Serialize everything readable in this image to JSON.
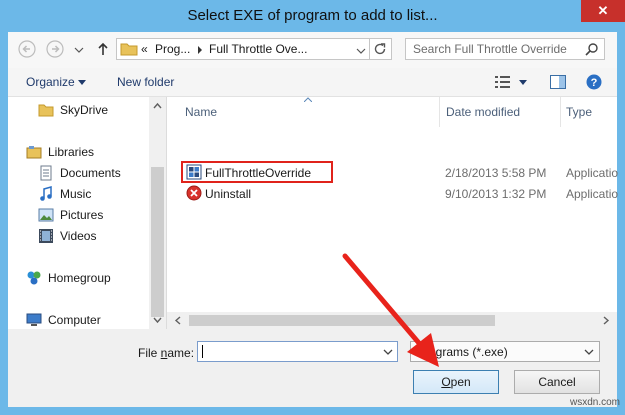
{
  "window": {
    "title": "Select EXE of program to add to list...",
    "close_glyph": "✕"
  },
  "address": {
    "overflow": "«",
    "crumbs": [
      "Prog...",
      "Full Throttle Ove..."
    ]
  },
  "search": {
    "placeholder": "Search Full Throttle Override"
  },
  "toolbar": {
    "organize": "Organize",
    "new_folder": "New folder"
  },
  "nav": {
    "items": [
      {
        "label": "SkyDrive",
        "icon": "skydrive-folder-icon"
      },
      {
        "label": "Libraries",
        "icon": "libraries-icon"
      },
      {
        "label": "Documents",
        "icon": "documents-icon"
      },
      {
        "label": "Music",
        "icon": "music-icon"
      },
      {
        "label": "Pictures",
        "icon": "pictures-icon"
      },
      {
        "label": "Videos",
        "icon": "videos-icon"
      },
      {
        "label": "Homegroup",
        "icon": "homegroup-icon"
      },
      {
        "label": "Computer",
        "icon": "computer-icon"
      }
    ]
  },
  "columns": {
    "name": "Name",
    "date": "Date modified",
    "type": "Type"
  },
  "files": [
    {
      "name": "FullThrottleOverride",
      "date": "2/18/2013 5:58 PM",
      "type": "Applicatio",
      "icon": "app-exe-icon",
      "highlighted": true
    },
    {
      "name": "Uninstall",
      "date": "9/10/2013 1:32 PM",
      "type": "Applicatio",
      "icon": "uninstall-icon",
      "highlighted": false
    }
  ],
  "footer": {
    "file_name_label_pre": "File ",
    "file_name_label_u": "n",
    "file_name_label_post": "ame:",
    "file_name_value": "",
    "filter": "Programs (*.exe)",
    "open_u": "O",
    "open_rest": "pen",
    "cancel": "Cancel"
  },
  "watermark": "wsxdn.com",
  "colors": {
    "frame": "#6cb8e8",
    "close": "#c7302b",
    "highlight": "#e0231b",
    "arrow": "#e8231b"
  }
}
